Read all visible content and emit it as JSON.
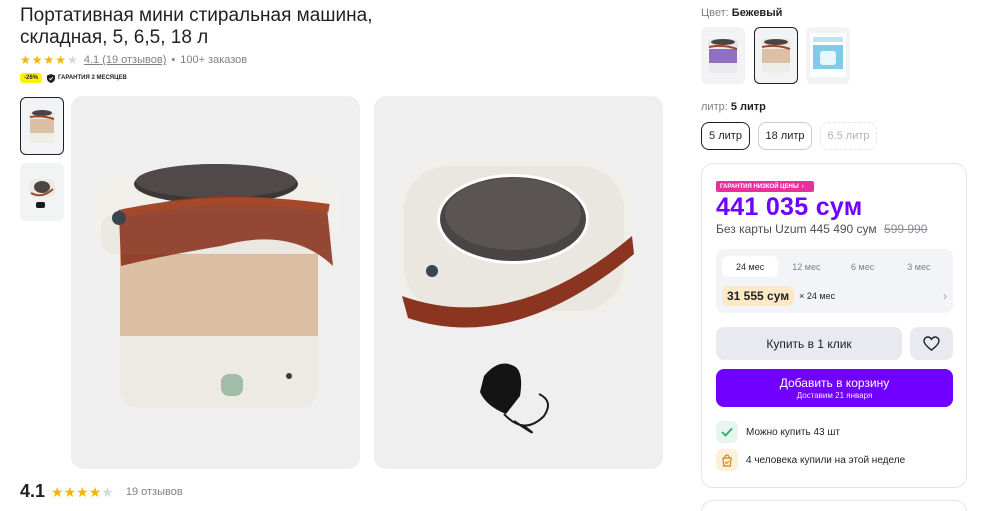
{
  "product": {
    "title": "Портативная мини стиральная машина, складная, 5, 6,5, 18 л",
    "rating": "4.1",
    "reviews_link": "(19 отзывов)",
    "orders": "100+ заказов",
    "discount_badge": "-26%",
    "guarantee_badge": "ГАРАНТИЯ 2 МЕСЯЦЕВ",
    "thumbnails": [
      "washer-front-thumb",
      "washer-top-thumb"
    ],
    "photos": [
      "washer-front-photo",
      "washer-top-with-charger-photo"
    ]
  },
  "reviews_summary": {
    "rating": "4.1",
    "count": "19 отзывов",
    "stars_filled": 4,
    "stars_total": 5
  },
  "options": {
    "color_label": "Цвет:",
    "color_value": "Бежевый",
    "colors": [
      "purple",
      "beige",
      "blue"
    ],
    "selected_color": "beige",
    "liter_label": "литр:",
    "liter_value": "5 литр",
    "liters": [
      {
        "label": "5 литр",
        "state": "active"
      },
      {
        "label": "18 литр",
        "state": "normal"
      },
      {
        "label": "6.5 литр",
        "state": "disabled"
      }
    ]
  },
  "price": {
    "badge": "ГАРАНТИЯ НИЗКОЙ ЦЕНЫ",
    "main": "441 035 сум",
    "without_card": "Без карты Uzum 445 490 сум",
    "old": "599 990"
  },
  "installment": {
    "periods": [
      "24 мес",
      "12 мес",
      "6 мес",
      "3 мес"
    ],
    "active_period": "24 мес",
    "amount": "31 555 сум",
    "times": "× 24 мес"
  },
  "actions": {
    "buy_one_click": "Купить в 1 клик",
    "add_to_cart": "Добавить в корзину",
    "delivery": "Доставим 21 января"
  },
  "info": {
    "stock": "Можно купить 43 шт",
    "bought": "4 человека купили на этой неделе"
  },
  "colors": {
    "accent": "#7000ff",
    "pink": "#ea2e9c",
    "star": "#f5b400",
    "installment_bg": "#fde9c6"
  }
}
